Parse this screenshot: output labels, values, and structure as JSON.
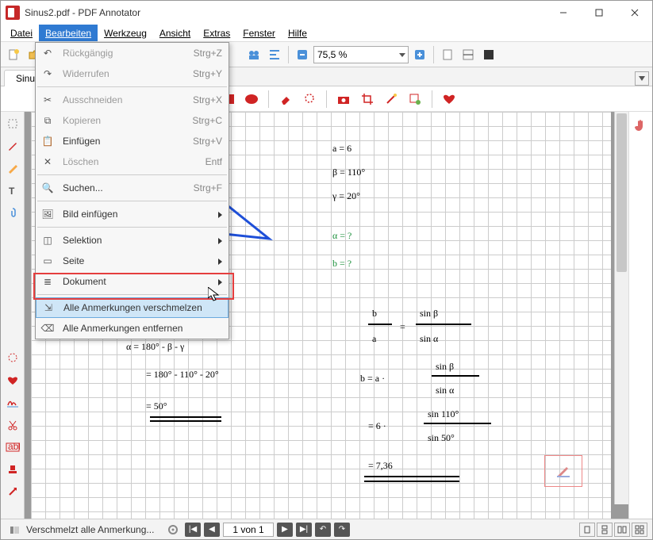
{
  "title": "Sinus2.pdf - PDF Annotator",
  "menu": {
    "datei": "Datei",
    "bearbeiten": "Bearbeiten",
    "werkzeug": "Werkzeug",
    "ansicht": "Ansicht",
    "extras": "Extras",
    "fenster": "Fenster",
    "hilfe": "Hilfe"
  },
  "zoom": "75,5 %",
  "tab": "Sinus2",
  "dropdown": {
    "undo": "Rückgängig",
    "undo_sc": "Strg+Z",
    "redo": "Widerrufen",
    "redo_sc": "Strg+Y",
    "cut": "Ausschneiden",
    "cut_sc": "Strg+X",
    "copy": "Kopieren",
    "copy_sc": "Strg+C",
    "paste": "Einfügen",
    "paste_sc": "Strg+V",
    "delete": "Löschen",
    "delete_sc": "Entf",
    "find": "Suchen...",
    "find_sc": "Strg+F",
    "insertimg": "Bild einfügen",
    "selection": "Selektion",
    "page": "Seite",
    "document": "Dokument",
    "merge": "Alle Anmerkungen verschmelzen",
    "remove": "Alle Anmerkungen entfernen"
  },
  "page_nav": "1 von 1",
  "status": "Verschmelzt alle Anmerkung...",
  "math": {
    "l1": "a = 6",
    "l2": "β = 110°",
    "l3": "γ = 20°",
    "l4": "α = ?",
    "l5": "b = ?",
    "c1": "α = 180° - β - γ",
    "c2": "= 180° - 110° - 20°",
    "c3": "= 50°",
    "r1": "b",
    "r2": "a",
    "r3": "sin β",
    "r4": "sin α",
    "r5": "b = a ·",
    "r6": "sin β",
    "r7": "sin α",
    "r8": "= 6 ·",
    "r9": "sin 110°",
    "r10": "sin 50°",
    "r11": "= 7,36"
  }
}
